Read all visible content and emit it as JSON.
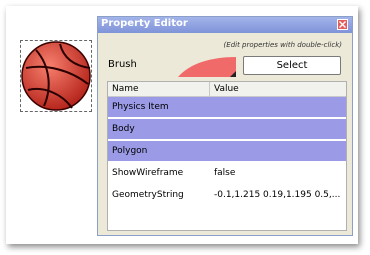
{
  "window": {
    "title": "Property Editor",
    "hint": "(Edit properties with double-click)"
  },
  "brush": {
    "label": "Brush",
    "button_label": "Select",
    "color": "#f06a6a"
  },
  "table": {
    "headers": {
      "name": "Name",
      "value": "Value"
    },
    "rows": [
      {
        "name": "Physics Item",
        "value": "",
        "group": true
      },
      {
        "name": "Body",
        "value": "",
        "group": true
      },
      {
        "name": "Polygon",
        "value": "",
        "group": true
      },
      {
        "name": "ShowWireframe",
        "value": "false",
        "group": false
      },
      {
        "name": "GeometryString",
        "value": "-0.1,1.215 0.19,1.195 0.5,...",
        "group": false
      }
    ]
  },
  "colors": {
    "group_row": "#9a9ae6",
    "ball": "#e3483c"
  }
}
